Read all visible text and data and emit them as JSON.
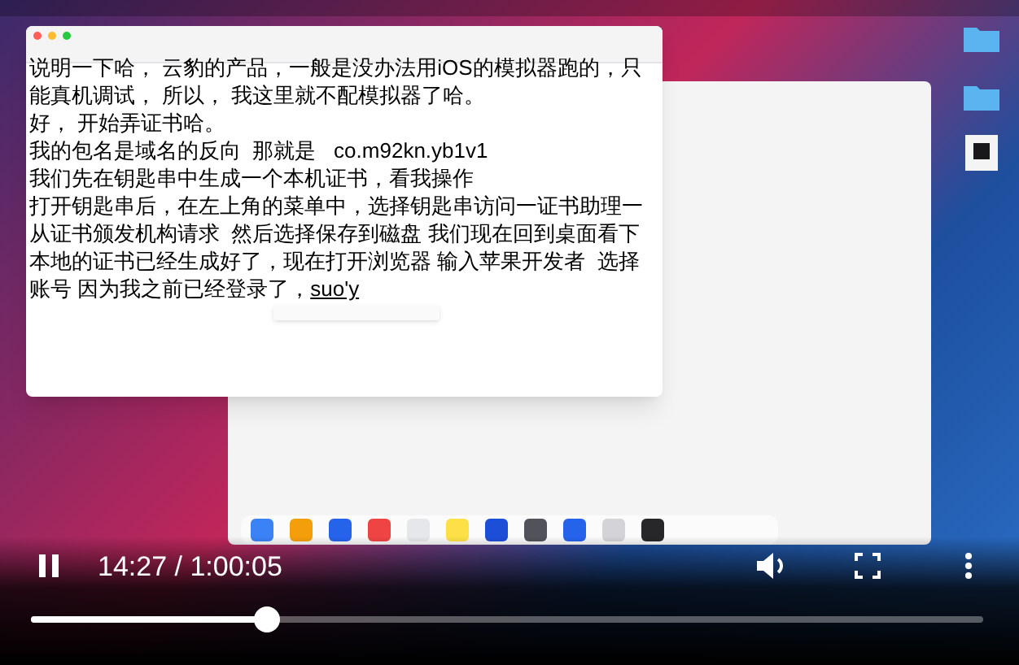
{
  "editor": {
    "lines": [
      "说明一下哈， 云豹的产品，一般是没办法用iOS的模拟器跑的，只",
      "能真机调试， 所以， 我这里就不配模拟器了哈。",
      "好， 开始弄证书哈。",
      "我的包名是域名的反向  那就是   co.m92kn.yb1v1",
      "我们先在钥匙串中生成一个本机证书，看我操作",
      "打开钥匙串后，在左上角的菜单中，选择钥匙串访问一证书助理一",
      "从证书颁发机构请求  然后选择保存到磁盘 我们现在回到桌面看下",
      "本地的证书已经生成好了，现在打开浏览器 输入苹果开发者  选择",
      "账号 因为我之前已经登录了，"
    ],
    "composition": "suo'y"
  },
  "player": {
    "playing": true,
    "time": "14:27 / 1:00:05",
    "progress": {
      "level": 0.248
    }
  }
}
